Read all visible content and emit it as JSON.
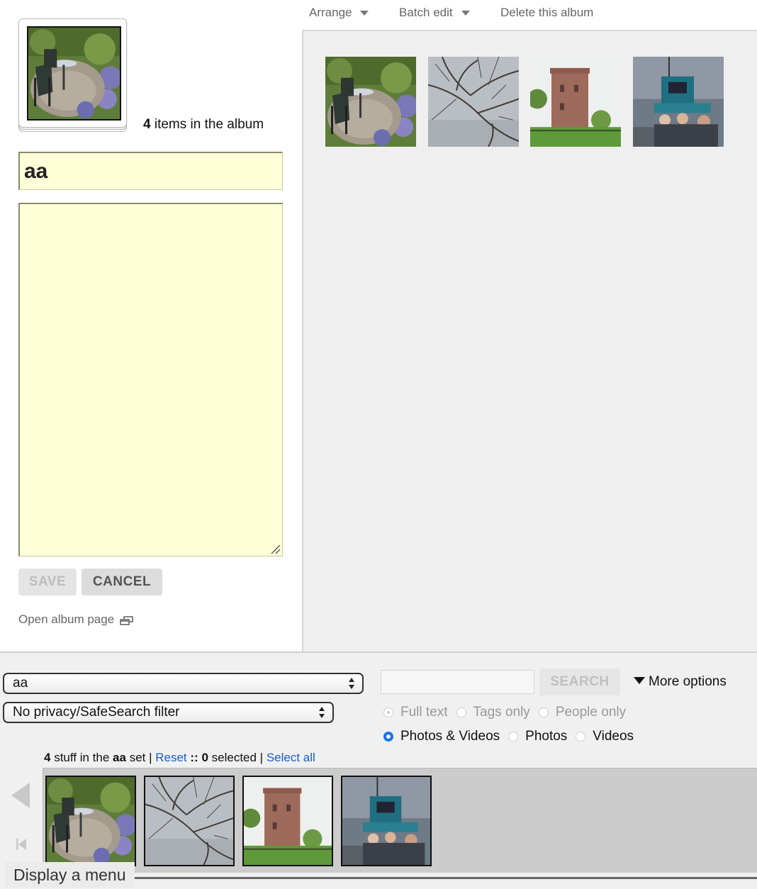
{
  "toolbar": {
    "arrange_label": "Arrange",
    "batch_edit_label": "Batch edit",
    "delete_label": "Delete this album"
  },
  "album": {
    "item_count": "4",
    "item_count_suffix": " items in the album",
    "title_value": "aa",
    "description_value": "",
    "save_label": "SAVE",
    "cancel_label": "CANCEL",
    "open_page_label": "Open album page",
    "photos": [
      {
        "name": "garden-chair-photo"
      },
      {
        "name": "tree-branches-photo"
      },
      {
        "name": "brick-tower-photo"
      },
      {
        "name": "boat-passengers-photo"
      }
    ]
  },
  "organizer": {
    "set_select_value": "aa",
    "filter_select_value": "No privacy/SafeSearch filter",
    "search_placeholder": "",
    "search_label": "SEARCH",
    "more_options_label": "More options",
    "search_scope": {
      "full_text": "Full text",
      "tags_only": "Tags only",
      "people_only": "People only",
      "selected": "Full text"
    },
    "media_type": {
      "photos_videos": "Photos & Videos",
      "photos": "Photos",
      "videos": "Videos",
      "selected": "Photos & Videos"
    },
    "status": {
      "count": "4",
      "stuff_text": " stuff in the ",
      "set_name": "aa",
      "set_text": " set | ",
      "reset_label": "Reset",
      "sep": " :: ",
      "selected_count": "0",
      "selected_text": " selected | ",
      "select_all_label": "Select all"
    },
    "tooltip": "Display a menu"
  },
  "colors": {
    "field_background": "#ffffd8",
    "link": "#1a5fc8",
    "radio_checked": "#1a73e8",
    "panel_background": "#efefef"
  }
}
